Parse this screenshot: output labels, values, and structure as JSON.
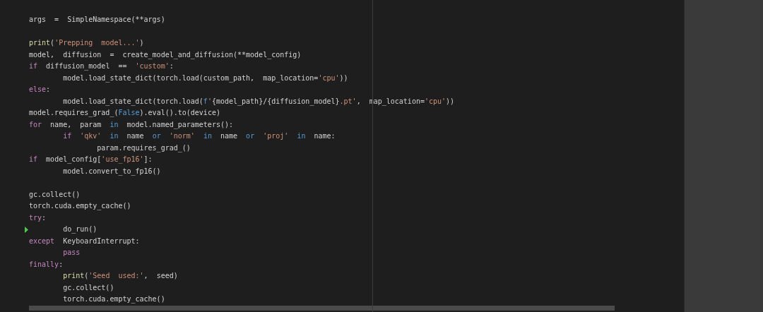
{
  "editor": {
    "blocks": [
      [
        {
          "current": false,
          "tokens": [
            {
              "kind": "plain",
              "text": "args  =  SimpleNamespace(**args)"
            }
          ]
        }
      ],
      [
        {
          "current": false,
          "tokens": [
            {
              "kind": "builtin",
              "text": "print"
            },
            {
              "kind": "plain",
              "text": "("
            },
            {
              "kind": "string",
              "text": "'Prepping  model...'"
            },
            {
              "kind": "plain",
              "text": ")"
            }
          ]
        },
        {
          "current": false,
          "tokens": [
            {
              "kind": "plain",
              "text": "model,  diffusion  =  create_model_and_diffusion(**model_config)"
            }
          ]
        },
        {
          "current": false,
          "tokens": [
            {
              "kind": "keyword",
              "text": "if"
            },
            {
              "kind": "plain",
              "text": "  diffusion_model  ==  "
            },
            {
              "kind": "string",
              "text": "'custom'"
            },
            {
              "kind": "plain",
              "text": ":"
            }
          ]
        },
        {
          "current": false,
          "tokens": [
            {
              "kind": "plain",
              "text": "        model.load_state_dict(torch.load(custom_path,  map_location="
            },
            {
              "kind": "string",
              "text": "'cpu'"
            },
            {
              "kind": "plain",
              "text": "))"
            }
          ]
        },
        {
          "current": false,
          "tokens": [
            {
              "kind": "keyword",
              "text": "else"
            },
            {
              "kind": "plain",
              "text": ":"
            }
          ]
        },
        {
          "current": false,
          "tokens": [
            {
              "kind": "plain",
              "text": "        model.load_state_dict(torch.load("
            },
            {
              "kind": "constant",
              "text": "f"
            },
            {
              "kind": "string",
              "text": "'"
            },
            {
              "kind": "plain",
              "text": "{model_path}/{diffusion_model}"
            },
            {
              "kind": "string",
              "text": ".pt'"
            },
            {
              "kind": "plain",
              "text": ",  map_location="
            },
            {
              "kind": "string",
              "text": "'cpu'"
            },
            {
              "kind": "plain",
              "text": "))"
            }
          ]
        },
        {
          "current": false,
          "tokens": [
            {
              "kind": "plain",
              "text": "model.requires_grad_("
            },
            {
              "kind": "constant",
              "text": "False"
            },
            {
              "kind": "plain",
              "text": ").eval().to(device)"
            }
          ]
        },
        {
          "current": false,
          "tokens": [
            {
              "kind": "keyword",
              "text": "for"
            },
            {
              "kind": "plain",
              "text": "  name,  param  "
            },
            {
              "kind": "operator",
              "text": "in"
            },
            {
              "kind": "plain",
              "text": "  model.named_parameters():"
            }
          ]
        },
        {
          "current": false,
          "tokens": [
            {
              "kind": "keyword",
              "text": "        if"
            },
            {
              "kind": "string",
              "text": "  'qkv'"
            },
            {
              "kind": "operator",
              "text": "  in"
            },
            {
              "kind": "plain",
              "text": "  name"
            },
            {
              "kind": "operator",
              "text": "  or"
            },
            {
              "kind": "string",
              "text": "  'norm'"
            },
            {
              "kind": "operator",
              "text": "  in"
            },
            {
              "kind": "plain",
              "text": "  name"
            },
            {
              "kind": "operator",
              "text": "  or"
            },
            {
              "kind": "string",
              "text": "  'proj'"
            },
            {
              "kind": "operator",
              "text": "  in"
            },
            {
              "kind": "plain",
              "text": "  name:"
            }
          ]
        },
        {
          "current": false,
          "tokens": [
            {
              "kind": "plain",
              "text": "                param.requires_grad_()"
            }
          ]
        },
        {
          "current": false,
          "tokens": [
            {
              "kind": "keyword",
              "text": "if"
            },
            {
              "kind": "plain",
              "text": "  model_config["
            },
            {
              "kind": "string",
              "text": "'use_fp16'"
            },
            {
              "kind": "plain",
              "text": "]:"
            }
          ]
        },
        {
          "current": false,
          "tokens": [
            {
              "kind": "plain",
              "text": "        model.convert_to_fp16()"
            }
          ]
        }
      ],
      [
        {
          "current": false,
          "tokens": [
            {
              "kind": "plain",
              "text": "gc.collect()"
            }
          ]
        },
        {
          "current": false,
          "tokens": [
            {
              "kind": "plain",
              "text": "torch.cuda.empty_cache()"
            }
          ]
        },
        {
          "current": false,
          "tokens": [
            {
              "kind": "keyword",
              "text": "try"
            },
            {
              "kind": "plain",
              "text": ":"
            }
          ]
        },
        {
          "current": true,
          "tokens": [
            {
              "kind": "plain",
              "text": "        do_run()"
            }
          ]
        },
        {
          "current": false,
          "tokens": [
            {
              "kind": "keyword",
              "text": "except"
            },
            {
              "kind": "plain",
              "text": "  KeyboardInterrupt:"
            }
          ]
        },
        {
          "current": false,
          "tokens": [
            {
              "kind": "keyword",
              "text": "        pass"
            }
          ]
        },
        {
          "current": false,
          "tokens": [
            {
              "kind": "keyword",
              "text": "finally"
            },
            {
              "kind": "plain",
              "text": ":"
            }
          ]
        },
        {
          "current": false,
          "tokens": [
            {
              "kind": "builtin",
              "text": "        print"
            },
            {
              "kind": "plain",
              "text": "("
            },
            {
              "kind": "string",
              "text": "'Seed  used:'"
            },
            {
              "kind": "plain",
              "text": ",  seed)"
            }
          ]
        },
        {
          "current": false,
          "tokens": [
            {
              "kind": "plain",
              "text": "        gc.collect()"
            }
          ]
        },
        {
          "current": false,
          "tokens": [
            {
              "kind": "plain",
              "text": "        torch.cuda.empty_cache()"
            }
          ]
        }
      ]
    ]
  }
}
